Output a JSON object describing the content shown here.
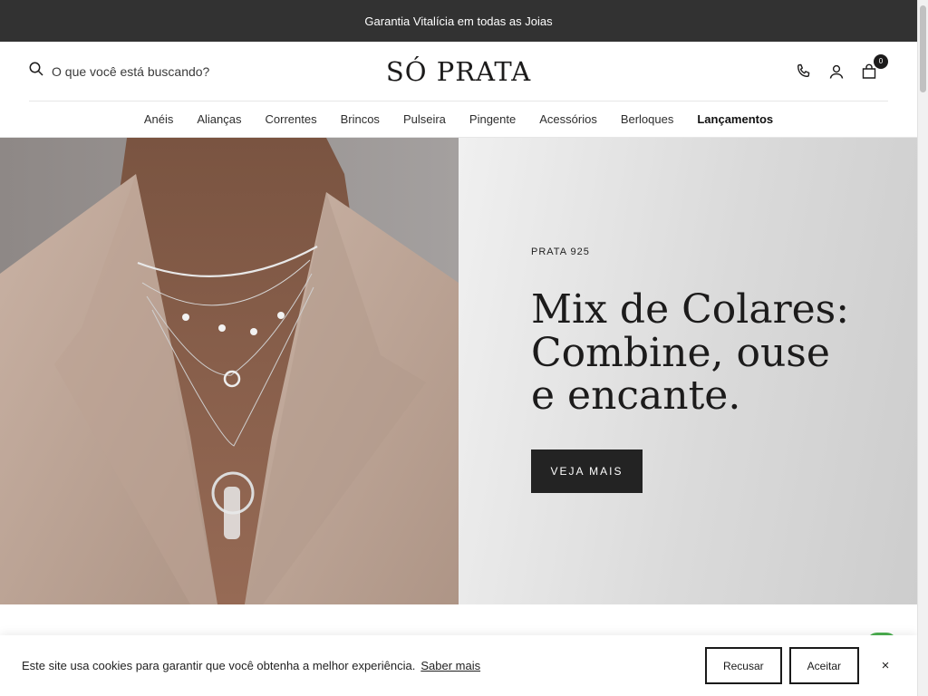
{
  "announcement": {
    "text": "Garantia Vitalícia em todas as Joias"
  },
  "header": {
    "search_placeholder": "O que você está buscando?",
    "logo": "SÓ PRATA",
    "cart_count": "0"
  },
  "nav": {
    "items": [
      {
        "label": "Anéis"
      },
      {
        "label": "Alianças"
      },
      {
        "label": "Correntes"
      },
      {
        "label": "Brincos"
      },
      {
        "label": "Pulseira"
      },
      {
        "label": "Pingente"
      },
      {
        "label": "Acessórios"
      },
      {
        "label": "Berloques"
      },
      {
        "label": "Lançamentos"
      }
    ]
  },
  "hero": {
    "eyebrow": "PRATA 925",
    "headline": "Mix de Colares: Combine, ouse e encante.",
    "cta": "VEJA MAIS"
  },
  "cookie": {
    "text": "Este site usa cookies para garantir que você obtenha a melhor experiência.",
    "link": "Saber mais",
    "decline": "Recusar",
    "accept": "Aceitar",
    "close": "×"
  },
  "colors": {
    "announcement_bg": "#323232",
    "cta_bg": "#232323",
    "text": "#1c1b1b"
  },
  "icons": [
    "search-icon",
    "phone-icon",
    "account-icon",
    "cart-icon",
    "close-icon",
    "whatsapp-icon"
  ]
}
